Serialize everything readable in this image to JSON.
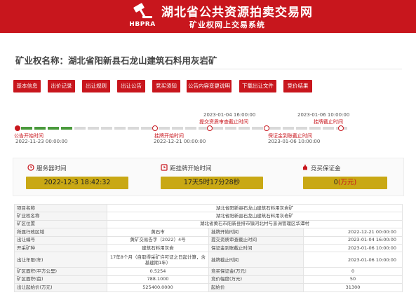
{
  "header": {
    "title": "湖北省公共资源拍卖交易网",
    "subtitle": "矿业权网上交易系统",
    "logo_text": "HBPRA"
  },
  "page": {
    "title_prefix": "矿业权名称：",
    "title_name": "湖北省阳新县石龙山建筑石料用灰岩矿"
  },
  "tabs": [
    "基本信息",
    "出价记录",
    "出让规则",
    "出让公告",
    "竞买须知",
    "公告内容变更说明",
    "下载出让文件",
    "竞价结果"
  ],
  "timeline": {
    "top_events": [
      {
        "date": "2023-01-04 16:00:00",
        "label": "提交资质审查截止时间"
      },
      {
        "date": "2023-01-06 10:00:00",
        "label": "挂牌截止时间"
      }
    ],
    "bottom_events": [
      {
        "label": "公告开始时间",
        "date": "2022-11-23 00:00:00"
      },
      {
        "label": "挂牌开始时间",
        "date": "2022-12-21 00:00:00"
      },
      {
        "label": "保证金到账截止时间",
        "date": "2023-01-06 10:00:00"
      }
    ],
    "colors": {
      "done": "#4a9a3c",
      "pending": "#d9d9d9",
      "accent": "#c8161d"
    }
  },
  "info": {
    "server_time_label": "服务器时间",
    "server_time": "2022-12-3 18:42:32",
    "countdown_label": "距挂牌开始时间",
    "countdown": "17天5时17分28秒",
    "deposit_label": "竞买保证金",
    "deposit_value": "0",
    "deposit_unit": "(万元)"
  },
  "table": {
    "project_name_label": "项目名称",
    "project_name": "湖北省阳新县石龙山建筑石料用灰岩矿",
    "mine_name_label": "矿业权名称",
    "mine_name": "湖北省阳新县石龙山建筑石料用灰岩矿",
    "location_label": "矿区位置",
    "location": "湖北省黄石市阳新县排市镇河北村与澎洲管理区华潭村",
    "rows": [
      {
        "l1": "所属行政区域",
        "v1": "黄石市",
        "l2": "挂牌开始时间",
        "v2": "2022-12-21 00:00:00"
      },
      {
        "l1": "出让编号",
        "v1": "黄矿交易告字（2022）4号",
        "l2": "提交资质审查截止时间",
        "v2": "2023-01-04 16:00:00"
      },
      {
        "l1": "开采矿种",
        "v1": "建筑石料用灰岩",
        "l2": "保证金到账截止时间",
        "v2": "2023-01-06 10:00:00"
      },
      {
        "l1": "出让年限(年)",
        "v1": "17年8个月（自取得采矿许可证之日起计算，含基建期1年）",
        "l2": "挂牌截止时间",
        "v2": "2023-01-06 10:00:00"
      },
      {
        "l1": "矿区面积(平方公里)",
        "v1": "0.5254",
        "l2": "竞买保证金(万元)",
        "v2": "0"
      },
      {
        "l1": "矿区面积(亩)",
        "v1": "788.1000",
        "l2": "竞价幅度(万元)",
        "v2": "50"
      },
      {
        "l1": "出让起始价(万元)",
        "v1": "525400.0000",
        "l2": "起始价",
        "v2": "31300"
      }
    ]
  }
}
